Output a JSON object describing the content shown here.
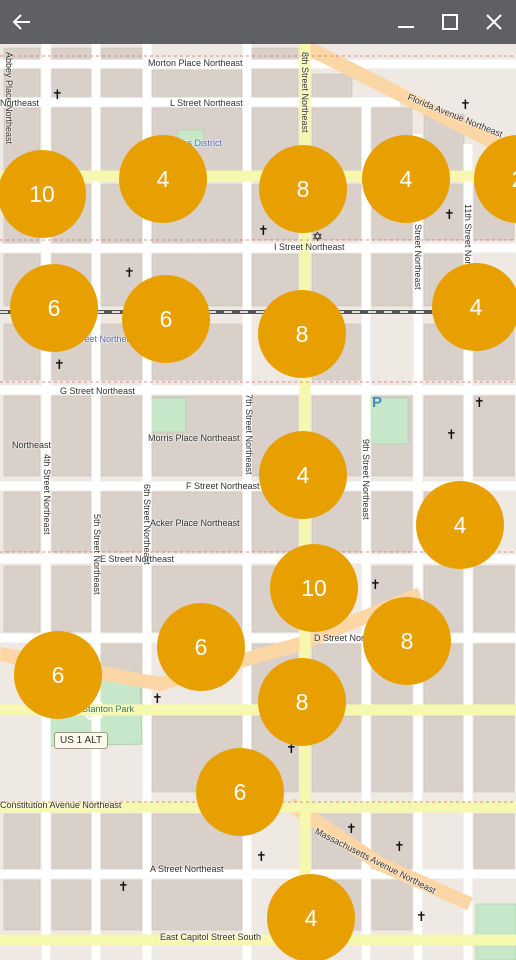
{
  "window": {
    "back_icon": "arrow-left-icon",
    "minimize_icon": "minimize-icon",
    "maximize_icon": "maximize-icon",
    "close_icon": "close-icon"
  },
  "colors": {
    "titlebar": "#5f6064",
    "cluster": "#e8a000",
    "map_background": "#f2efe9",
    "building": "#d9d0c9",
    "major_road": "#f7f8b0",
    "arterial": "#fcd6a4"
  },
  "map": {
    "street_labels": [
      "Morton Place Northeast",
      "L Street Northeast",
      "Florida Avenue Northeast",
      "8th Street Northeast",
      "4th Street Northeast",
      "5th Street Northeast",
      "6th Street Northeast",
      "7th Street Northeast",
      "9th Street Northeast",
      "10th Street Northeast",
      "11th Street Northeast",
      "Abbey Place Northeast",
      "Northeast",
      "I Street Northeast",
      "G Street Northeast",
      "Morris Place Northeast",
      "F Street Northeast",
      "Acker Place Northeast",
      "E Street Northeast",
      "D Street Northeast",
      "Constitution Avenue Northeast",
      "Massachusetts Avenue Northeast",
      "A Street Northeast",
      "East Capitol Street South",
      "Northeast"
    ],
    "place_labels": [
      "Atlas District",
      "Stanton Park",
      "5th Street Northeast"
    ],
    "route_shield": "US 1 ALT",
    "parking_symbol": "P"
  },
  "clusters": [
    {
      "count": "10"
    },
    {
      "count": "4"
    },
    {
      "count": "8"
    },
    {
      "count": "4"
    },
    {
      "count": "2"
    },
    {
      "count": "6"
    },
    {
      "count": "6"
    },
    {
      "count": "8"
    },
    {
      "count": "4"
    },
    {
      "count": "4"
    },
    {
      "count": "4"
    },
    {
      "count": "10"
    },
    {
      "count": "6"
    },
    {
      "count": "8"
    },
    {
      "count": "6"
    },
    {
      "count": "8"
    },
    {
      "count": "6"
    },
    {
      "count": "4"
    }
  ]
}
